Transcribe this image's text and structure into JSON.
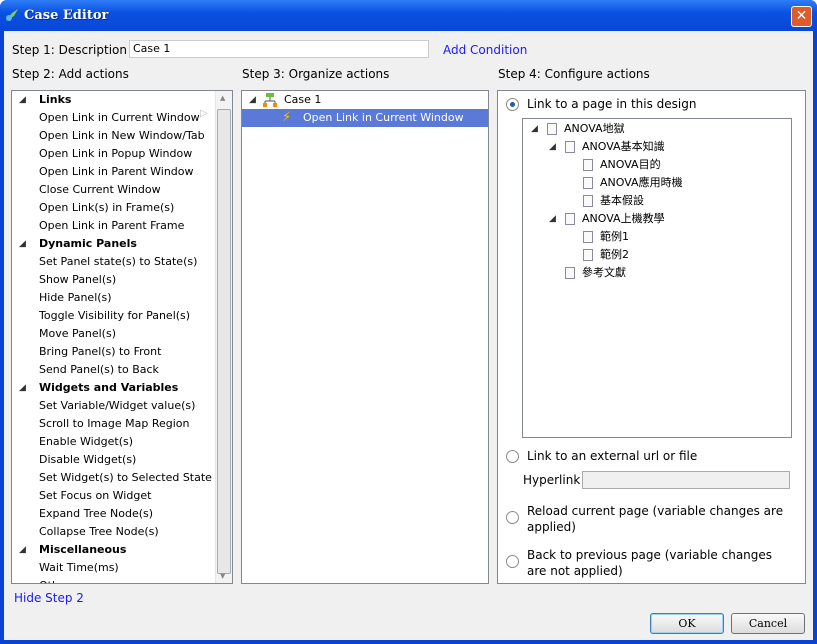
{
  "window": {
    "title": "Case Editor",
    "close": "✕"
  },
  "step1": {
    "label": "Step 1: Description",
    "value": "Case 1",
    "add_condition": "Add Condition"
  },
  "step2": {
    "label": "Step 2: Add actions",
    "groups": [
      {
        "name": "Links",
        "items": [
          "Open Link in Current Window",
          "Open Link in New Window/Tab",
          "Open Link in Popup Window",
          "Open Link in Parent Window",
          "Close Current Window",
          "Open Link(s) in Frame(s)",
          "Open Link in Parent Frame"
        ]
      },
      {
        "name": "Dynamic Panels",
        "items": [
          "Set Panel state(s) to State(s)",
          "Show Panel(s)",
          "Hide Panel(s)",
          "Toggle Visibility for Panel(s)",
          "Move Panel(s)",
          "Bring Panel(s) to Front",
          "Send Panel(s) to Back"
        ]
      },
      {
        "name": "Widgets and Variables",
        "items": [
          "Set Variable/Widget value(s)",
          "Scroll to Image Map Region",
          "Enable Widget(s)",
          "Disable Widget(s)",
          "Set Widget(s) to Selected State",
          "Set Focus on Widget",
          "Expand Tree Node(s)",
          "Collapse Tree Node(s)"
        ]
      },
      {
        "name": "Miscellaneous",
        "items": [
          "Wait Time(ms)",
          "Other"
        ]
      }
    ],
    "hide": "Hide Step 2"
  },
  "step3": {
    "label": "Step 3: Organize actions",
    "case": "Case 1",
    "action": "Open Link in Current Window"
  },
  "step4": {
    "label": "Step 4: Configure actions",
    "opt_page": "Link to a page in this design",
    "tree": [
      {
        "label": "ANOVA地獄",
        "level": 0,
        "expand": true
      },
      {
        "label": "ANOVA基本知識",
        "level": 1,
        "expand": true
      },
      {
        "label": "ANOVA目的",
        "level": 2
      },
      {
        "label": "ANOVA應用時機",
        "level": 2
      },
      {
        "label": "基本假設",
        "level": 2
      },
      {
        "label": "ANOVA上機教學",
        "level": 1,
        "expand": true
      },
      {
        "label": "範例1",
        "level": 2
      },
      {
        "label": "範例2",
        "level": 2
      },
      {
        "label": "參考文獻",
        "level": 1
      }
    ],
    "opt_url": "Link to an external url or file",
    "hyperlink_label": "Hyperlink",
    "hyperlink_value": "",
    "opt_reload": "Reload current page (variable changes are applied)",
    "opt_back": "Back to previous page (variable changes are not applied)",
    "selected": "page"
  },
  "buttons": {
    "ok": "OK",
    "cancel": "Cancel"
  },
  "colors": {
    "titlebar": "#0a52e0",
    "selection": "#5b79d6",
    "link": "#1a1aff"
  }
}
